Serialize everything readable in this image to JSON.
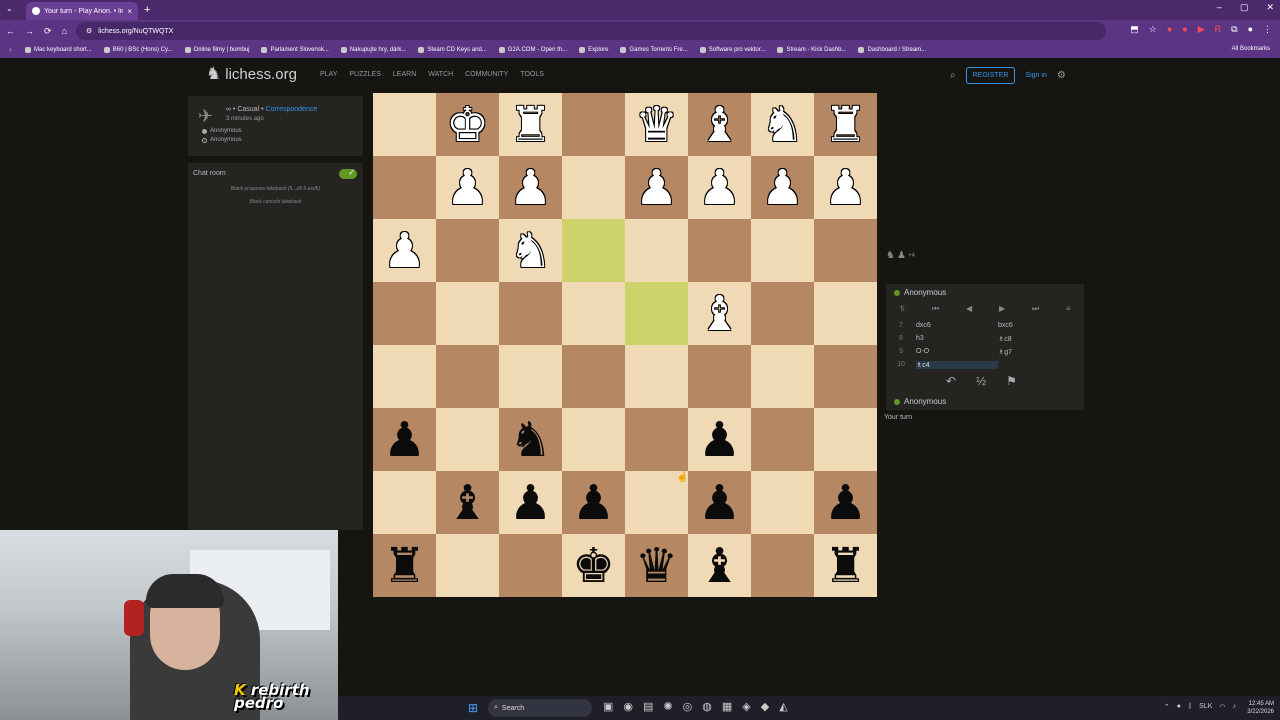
{
  "browser": {
    "tab_title": "Your turn - Play Anon. • liches...",
    "url": "lichess.org/NuQTWQTX",
    "bookmarks": [
      "Mac keyboard short...",
      "B60 | BSc (Hons) Cy...",
      "Online filmy | bombuj",
      "Parlament Slovensk...",
      "Nakupujte hry, dárk...",
      "Steam CD Keys and...",
      "G2A.COM - Open th...",
      "Explore",
      "Games Torrents Fre...",
      "Software pro vektor...",
      "Stream - Kick Dashb...",
      "Dashboard / Stream..."
    ],
    "all_bookmarks": "All Bookmarks"
  },
  "header": {
    "logo": "lichess.org",
    "nav": [
      "PLAY",
      "PUZZLES",
      "LEARN",
      "WATCH",
      "COMMUNITY",
      "TOOLS"
    ],
    "register": "REGISTER",
    "signin": "Sign in"
  },
  "game": {
    "mode": "∞ • Casual •",
    "type": "Correspondence",
    "time": "3 minutes ago",
    "player1": "Anonymous",
    "player2": "Anonymous"
  },
  "chat": {
    "title": "Chat room",
    "messages": [
      "Black proposes takeback (5...d5 6.exd5)",
      "Black cancels takeback"
    ]
  },
  "board": {
    "orientation": "black",
    "highlight_squares": [
      "e3",
      "d4"
    ],
    "ranks": [
      [
        "",
        "wK",
        "wR",
        "",
        "wQ",
        "wB",
        "wN",
        "wR"
      ],
      [
        "",
        "wP",
        "wP",
        "",
        "wP",
        "wP",
        "wP",
        "wP"
      ],
      [
        "wP",
        "",
        "wN",
        "",
        "",
        "",
        "",
        ""
      ],
      [
        "",
        "",
        "",
        "",
        "",
        "wB",
        "",
        ""
      ],
      [
        "",
        "",
        "",
        "",
        "",
        "",
        "",
        ""
      ],
      [
        "bP",
        "",
        "bN",
        "",
        "",
        "bP",
        "",
        ""
      ],
      [
        "",
        "bB",
        "bP",
        "bP",
        "",
        "bP",
        "",
        "bP"
      ],
      [
        "bR",
        "",
        "",
        "bK",
        "bQ",
        "bB",
        "",
        "bR"
      ]
    ]
  },
  "right_panel": {
    "material": "+4",
    "top_player": "Anonymous",
    "bottom_player": "Anonymous",
    "moves": [
      {
        "num": "7",
        "white": "dxc6",
        "black": "bxc6"
      },
      {
        "num": "8",
        "white": "h3",
        "black": "♗c8"
      },
      {
        "num": "9",
        "white": "O-O",
        "black": "♗g7"
      },
      {
        "num": "10",
        "white": "♗c4",
        "black": ""
      }
    ],
    "status": "Your turn"
  },
  "overlay": {
    "brand_line1": "rebirth",
    "brand_line2": "pedro"
  },
  "taskbar": {
    "search": "Search",
    "lang": "SLK",
    "time": "12:45 AM",
    "date": "3/22/2026"
  }
}
